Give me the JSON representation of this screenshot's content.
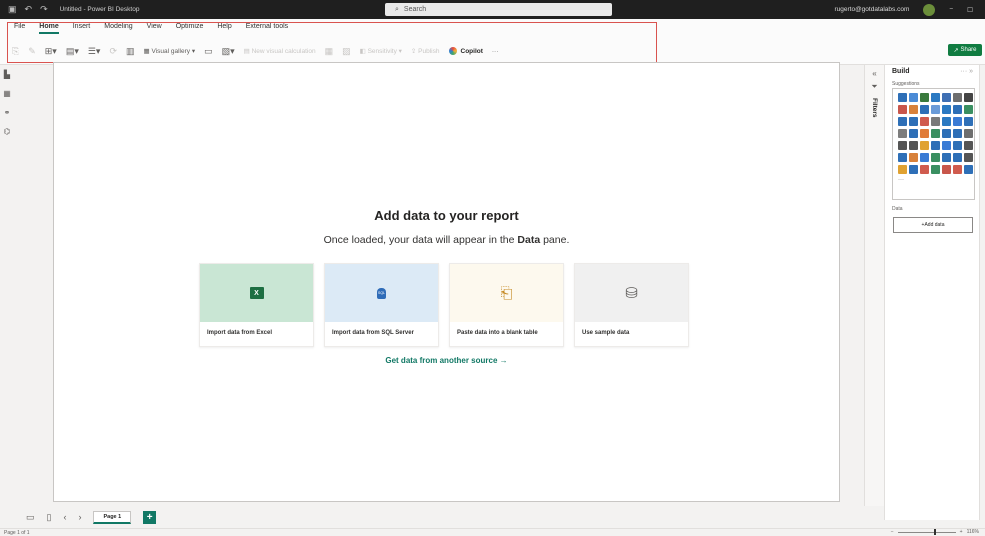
{
  "window": {
    "title": "Untitled - Power BI Desktop",
    "search_placeholder": "Search",
    "user_email": "rugerto@gotdatalabs.com",
    "min_glyph": "−",
    "max_glyph": "☐"
  },
  "ribbon": {
    "menu": [
      "File",
      "Home",
      "Insert",
      "Modeling",
      "View",
      "Optimize",
      "Help",
      "External tools"
    ],
    "tools": {
      "visual_gallery": "Visual gallery",
      "new_visual_calc": "New visual calculation",
      "sensitivity": "Sensitivity",
      "publish": "Publish",
      "copilot": "Copilot",
      "more": "···"
    },
    "share": "Share"
  },
  "canvas": {
    "title": "Add data to your report",
    "subtitle_pre": "Once loaded, your data will appear in the ",
    "subtitle_bold": "Data",
    "subtitle_post": " pane.",
    "cards": [
      {
        "label": "Import data from Excel",
        "icon": "excel-icon",
        "bg": "#c9e6d4"
      },
      {
        "label": "Import data from SQL Server",
        "icon": "sql-server-icon",
        "bg": "#dceaf6"
      },
      {
        "label": "Paste data into a blank table",
        "icon": "paste-icon",
        "bg": "#fdf9ee"
      },
      {
        "label": "Use sample data",
        "icon": "sample-data-icon",
        "bg": "#f0f0f0"
      }
    ],
    "excel_glyph": "X",
    "sql_glyph": "SQL",
    "get_data_link": "Get data from another source →"
  },
  "filters": {
    "label": "Filters",
    "collapse_glyph": "«"
  },
  "build": {
    "title": "Build",
    "options": "··· »",
    "suggestions_label": "Suggestions",
    "viz_colors": [
      "#2e6fb7",
      "#4b8bd6",
      "#3a7a3d",
      "#2b79c2",
      "#3f6fb3",
      "#6e6e6e",
      "#444",
      "#c8564b",
      "#d8813a",
      "#2e6fb7",
      "#6a9bd8",
      "#2b79c2",
      "#2e6fb7",
      "#3a8f61",
      "#2e6fb7",
      "#2e6fb7",
      "#d05b4e",
      "#7a7a7a",
      "#2b79c2",
      "#3a7bd5",
      "#2e6fb7",
      "#7d7d7d",
      "#2e6fb7",
      "#e07b39",
      "#3a8f61",
      "#2e6fb7",
      "#2e6fb7",
      "#6e6e6e",
      "#555",
      "#555",
      "#e0a232",
      "#2e6fb7",
      "#3a7bd5",
      "#2e6fb7",
      "#555",
      "#2e6fb7",
      "#d8813a",
      "#3a7bd5",
      "#3a8f61",
      "#2e6fb7",
      "#2e6fb7",
      "#555",
      "#e0a232",
      "#2e6fb7",
      "#d05b4e",
      "#3a8f61",
      "#c8564b",
      "#d05b4e",
      "#2e6fb7"
    ],
    "more_glyph": "···",
    "data_label": "Data",
    "add_data": "+Add data"
  },
  "pages": {
    "tab": "Page 1",
    "add": "+",
    "prev": "‹",
    "next": "›"
  },
  "status": {
    "page_of": "Page 1 of 1",
    "zoom_minus": "−",
    "zoom_plus": "+",
    "zoom": "116%"
  }
}
